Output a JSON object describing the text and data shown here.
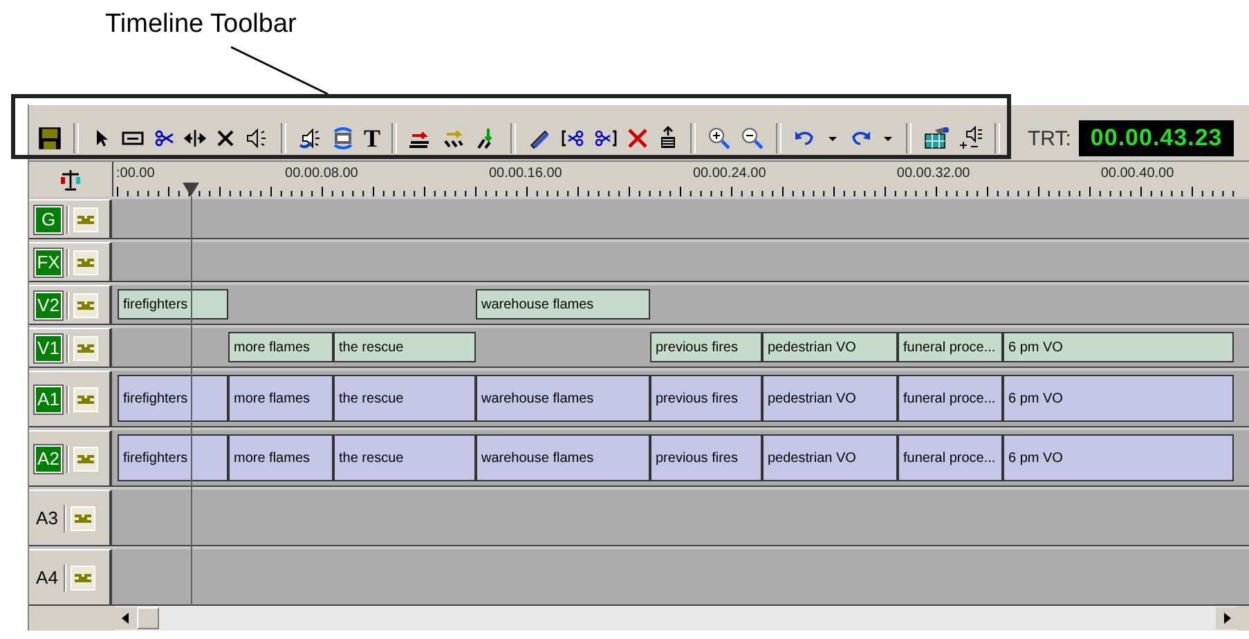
{
  "callout": "Timeline Toolbar",
  "toolbar": {
    "text_tool": "T",
    "trt_label": "TRT:",
    "trt_value": "00.00.43.23"
  },
  "ruler": {
    "labels": [
      ":00.00",
      "00.00.08.00",
      "00.00.16.00",
      "00.00.24.00",
      "00.00.32.00",
      "00.00.40.00"
    ]
  },
  "tracks": [
    {
      "name": "G",
      "kind": "video",
      "active": true
    },
    {
      "name": "FX",
      "kind": "video",
      "active": true
    },
    {
      "name": "V2",
      "kind": "video",
      "active": true,
      "clips": [
        {
          "kind": "clip",
          "label": "firefighters"
        },
        {
          "kind": "gap"
        },
        {
          "kind": "gap"
        },
        {
          "kind": "clip",
          "label": "warehouse flames"
        }
      ]
    },
    {
      "name": "V1",
      "kind": "video",
      "active": true,
      "clips": [
        {
          "kind": "gap"
        },
        {
          "kind": "clip",
          "label": "more flames"
        },
        {
          "kind": "clip",
          "label": "the rescue"
        },
        {
          "kind": "gap"
        },
        {
          "kind": "clip",
          "label": "previous fires"
        },
        {
          "kind": "clip",
          "label": "pedestrian VO"
        },
        {
          "kind": "clip",
          "label": "funeral proce..."
        },
        {
          "kind": "clip",
          "label": "6 pm VO"
        }
      ]
    },
    {
      "name": "A1",
      "kind": "audio",
      "active": true,
      "clips": [
        {
          "kind": "clip",
          "label": "firefighters"
        },
        {
          "kind": "clip",
          "label": "more flames"
        },
        {
          "kind": "clip",
          "label": "the rescue"
        },
        {
          "kind": "clip",
          "label": "warehouse flames"
        },
        {
          "kind": "clip",
          "label": "previous fires"
        },
        {
          "kind": "clip",
          "label": "pedestrian VO"
        },
        {
          "kind": "clip",
          "label": "funeral proce..."
        },
        {
          "kind": "clip",
          "label": "6 pm VO"
        }
      ]
    },
    {
      "name": "A2",
      "kind": "audio",
      "active": true,
      "clips": [
        {
          "kind": "clip",
          "label": "firefighters"
        },
        {
          "kind": "clip",
          "label": "more flames"
        },
        {
          "kind": "clip",
          "label": "the rescue"
        },
        {
          "kind": "clip",
          "label": "warehouse flames"
        },
        {
          "kind": "clip",
          "label": "previous fires"
        },
        {
          "kind": "clip",
          "label": "pedestrian VO"
        },
        {
          "kind": "clip",
          "label": "funeral proce..."
        },
        {
          "kind": "clip",
          "label": "6 pm VO"
        }
      ]
    },
    {
      "name": "A3",
      "kind": "audio",
      "active": false
    },
    {
      "name": "A4",
      "kind": "audio",
      "active": false
    }
  ]
}
